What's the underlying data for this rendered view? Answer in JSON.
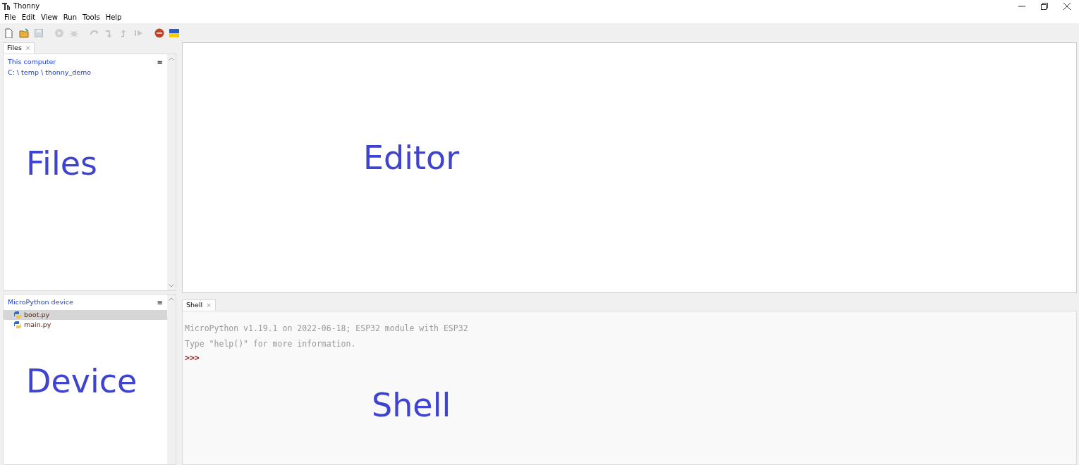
{
  "window": {
    "title": "Thonny"
  },
  "menu": [
    "File",
    "Edit",
    "View",
    "Run",
    "Tools",
    "Help"
  ],
  "toolbar": [
    {
      "kind": "new",
      "disabled": false
    },
    {
      "kind": "open",
      "disabled": false
    },
    {
      "kind": "save",
      "disabled": true
    },
    {
      "kind": "run",
      "disabled": true
    },
    {
      "kind": "debug",
      "disabled": true
    },
    {
      "kind": "stepover",
      "disabled": true
    },
    {
      "kind": "stepinto",
      "disabled": true
    },
    {
      "kind": "stepout",
      "disabled": true
    },
    {
      "kind": "resume",
      "disabled": true
    },
    {
      "kind": "stop",
      "disabled": false
    },
    {
      "kind": "flag",
      "disabled": false
    }
  ],
  "files_panel": {
    "tab": {
      "label": "Files",
      "close": "×",
      "selected": true
    },
    "menu_glyph": "≡",
    "location": "This computer",
    "path": "C: \\ temp \\ thonny_demo",
    "annotation": "Files"
  },
  "device_panel": {
    "title": "MicroPython device",
    "menu_glyph": "≡",
    "files": [
      {
        "name": "boot.py",
        "selected": true
      },
      {
        "name": "main.py",
        "selected": false
      }
    ],
    "annotation": "Device"
  },
  "editor": {
    "annotation": "Editor"
  },
  "shell": {
    "tab": {
      "label": "Shell",
      "close": "×",
      "selected": true
    },
    "lines": [
      {
        "kind": "output",
        "text": "MicroPython v1.19.1 on 2022-06-18; ESP32 module with ESP32"
      },
      {
        "kind": "output",
        "text": "Type \"help()\" for more information."
      },
      {
        "kind": "prompt",
        "text": ">>>"
      }
    ],
    "annotation": "Shell"
  }
}
